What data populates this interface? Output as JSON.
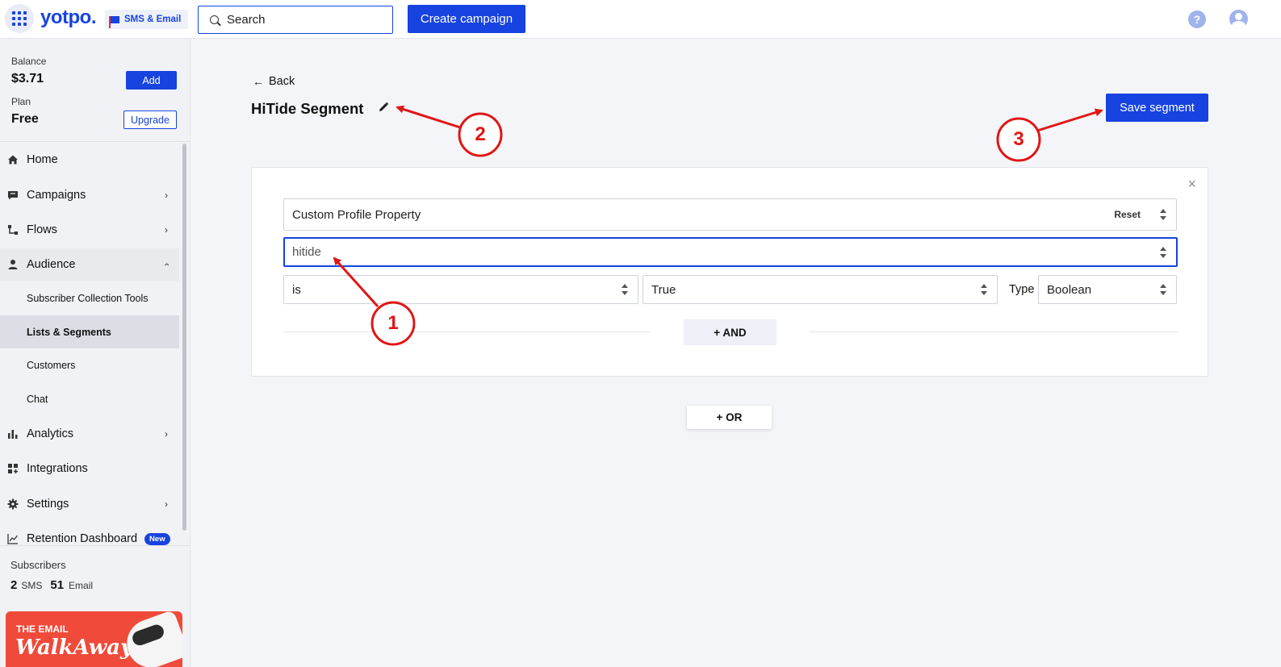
{
  "header": {
    "logo": "yotpo.",
    "product": "SMS & Email",
    "search_placeholder": "Search",
    "create_campaign": "Create campaign",
    "help": "?"
  },
  "account": {
    "balance_label": "Balance",
    "balance_value": "$3.71",
    "add_label": "Add",
    "plan_label": "Plan",
    "plan_value": "Free",
    "upgrade_label": "Upgrade"
  },
  "sidebar": {
    "home": "Home",
    "campaigns": "Campaigns",
    "flows": "Flows",
    "audience": "Audience",
    "audience_items": [
      "Subscriber Collection Tools",
      "Lists & Segments",
      "Customers",
      "Chat"
    ],
    "analytics": "Analytics",
    "integrations": "Integrations",
    "settings": "Settings",
    "retention": "Retention Dashboard",
    "new_badge": "New",
    "subscribers_label": "Subscribers",
    "sms_count": "2",
    "sms_label": "SMS",
    "email_count": "51",
    "email_label": "Email",
    "promo_line1": "THE EMAIL",
    "promo_line2": "WalkAway"
  },
  "main": {
    "back_label": "Back",
    "segment_title": "HiTide Segment",
    "save_label": "Save segment",
    "condition": {
      "property_type": "Custom Profile Property",
      "reset_label": "Reset",
      "property_name": "hitide",
      "operator": "is",
      "value": "True",
      "type_label": "Type",
      "type_value": "Boolean"
    },
    "and_label": "+ AND",
    "or_label": "+ OR"
  },
  "annotations": [
    "1",
    "2",
    "3"
  ],
  "colors": {
    "brand": "#1743e0",
    "annotation": "#e01616"
  }
}
